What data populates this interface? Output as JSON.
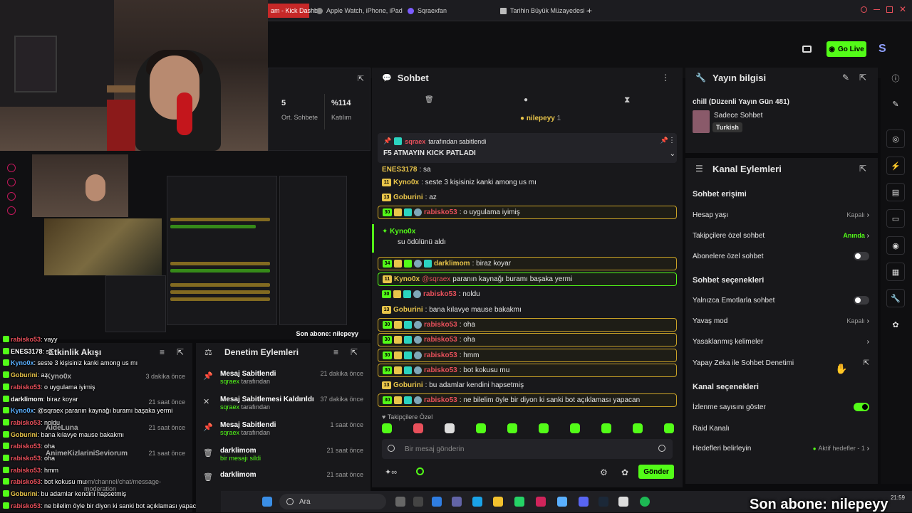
{
  "browser": {
    "tabs": [
      {
        "label": "am - Kick Dashb",
        "active": true
      },
      {
        "label": "Apple Watch, iPhone, iPad"
      },
      {
        "label": "Sqraexfan"
      },
      {
        "label": "Tarihin Büyük Müzayedesi –"
      }
    ]
  },
  "topbar": {
    "go_live": "Go Live",
    "brand": "S"
  },
  "stats": {
    "count": "5",
    "count_label": "Ort. Sohbete",
    "pct": "%114",
    "pct_label": "Katılım"
  },
  "preview": {
    "overlay_text": "Son abone: nilepeyy"
  },
  "left_chat": [
    {
      "user": "rabisko53",
      "text": ": vayy"
    },
    {
      "user": "ENES3178",
      "text": ": sa"
    },
    {
      "user": "Kyno0x",
      "text": ": seste 3 kişisiniz kanki among us mı"
    },
    {
      "user": "Goburini",
      "text": ": az"
    },
    {
      "user": "rabisko53",
      "text": ": o uygulama iyimiş"
    },
    {
      "user": "darklimom",
      "text": ": biraz koyar"
    },
    {
      "user": "Kyno0x",
      "text": ": @sqraex paranın kaynağı buramı başaka yermi"
    },
    {
      "user": "rabisko53",
      "text": ": noldu"
    },
    {
      "user": "Goburini",
      "text": ": bana kılavye mause bakakmı"
    },
    {
      "user": "rabisko53",
      "text": ": oha"
    },
    {
      "user": "rabisko53",
      "text": ": oha"
    },
    {
      "user": "rabisko53",
      "text": ": hmm"
    },
    {
      "user": "rabisko53",
      "text": ": bot kokusu mu"
    },
    {
      "user": "Goburini",
      "text": ": bu adamlar kendini hapsetmiş"
    },
    {
      "user": "rabisko53",
      "text": ": ne bilelim öyle bir diyon ki sanki bot açıklaması yapacan"
    }
  ],
  "etkinlik": {
    "title": "Etkinlik Akışı",
    "items": [
      {
        "name": "Kyno0x",
        "time": "3 dakika önce"
      },
      {
        "name": "",
        "time": "21 saat önce"
      },
      {
        "name": "AldeLuna",
        "time": "21 saat önce"
      },
      {
        "name": "AnimeKizlariniSeviorum",
        "time": "21 saat önce"
      }
    ],
    "url_fragment": "om/channel/chat/message-moderation"
  },
  "denetim": {
    "title": "Denetim Eylemleri",
    "items": [
      {
        "title": "Mesaj Sabitlendi",
        "sub": "sqraex",
        "sub2": " tarafından",
        "time": "21 dakika önce"
      },
      {
        "title": "Mesaj Sabitlemesi Kaldırıldı",
        "sub": "sqraex",
        "sub2": " tarafından",
        "time": "37 dakika önce"
      },
      {
        "title": "Mesaj Sabitlendi",
        "sub": "sqraex",
        "sub2": " tarafından",
        "time": "1 saat önce"
      },
      {
        "title": "darklimom",
        "sub": "bir mesajı sildi",
        "sub2": "",
        "time": "21 saat önce"
      },
      {
        "title": "darklimom",
        "sub": "",
        "sub2": "",
        "time": "21 saat önce"
      }
    ]
  },
  "sohbet": {
    "title": "Sohbet",
    "top_user": "nilepeyy",
    "top_count": "1",
    "pinned_by": "sqraex",
    "pinned_by_suffix": " tarafından sabitlendi",
    "pinned_text": "F5 ATMAYIN KICK PATLADI",
    "reward_user": "Kyno0x",
    "reward_text": "su ödülünü aldı",
    "follower_label": "Takipçilere Özel",
    "input_placeholder": "Bir mesaj gönderin",
    "send": "Gönder",
    "messages": [
      {
        "user": "ENES3178",
        "text": ": sa"
      },
      {
        "user": "Kyno0x",
        "text": ": seste 3 kişisiniz kanki among us mı"
      },
      {
        "user": "Goburini",
        "text": ": az"
      },
      {
        "user": "rabisko53",
        "text": ": o uygulama iyimiş"
      },
      {
        "user": "darklimom",
        "text": ": biraz koyar"
      },
      {
        "user": "Kyno0x",
        "mention": "@sqraex",
        "text": " paranın kaynağı buramı başaka yermi"
      },
      {
        "user": "rabisko53",
        "text": ": noldu"
      },
      {
        "user": "Goburini",
        "text": ": bana kılavye mause bakakmı"
      },
      {
        "user": "rabisko53",
        "text": ": oha"
      },
      {
        "user": "rabisko53",
        "text": ": oha"
      },
      {
        "user": "rabisko53",
        "text": ": hmm"
      },
      {
        "user": "rabisko53",
        "text": ": bot kokusu mu"
      },
      {
        "user": "Goburini",
        "text": ": bu adamlar kendini hapsetmiş"
      },
      {
        "user": "rabisko53",
        "text": ": ne bilelim öyle bir diyon ki sanki bot açıklaması yapacan"
      }
    ],
    "badge_30": "30",
    "badge_11": "11",
    "badge_13": "13",
    "badge_34": "34"
  },
  "yayin": {
    "title": "Yayın bilgisi",
    "stream_title": "chill (Düzenli Yayın Gün 481)",
    "category": "Sadece Sohbet",
    "language": "Turkish"
  },
  "kanal": {
    "title": "Kanal Eylemleri",
    "sec1": "Sohbet erişimi",
    "hesap": "Hesap yaşı",
    "hesap_val": "Kapalı",
    "takipci": "Takipçilere özel sohbet",
    "takipci_val": "Anında",
    "abone": "Abonelere özel sohbet",
    "sec2": "Sohbet seçenekleri",
    "emote": "Yalnızca Emotlarla sohbet",
    "yavas": "Yavaş mod",
    "yavas_val": "Kapalı",
    "yasak": "Yasaklanmış kelimeler",
    "ai": "Yapay Zeka ile Sohbet Denetimi",
    "sec3": "Kanal seçenekleri",
    "izlenme": "İzlenme sayısını göster",
    "raid": "Raid Kanalı",
    "hedef": "Hedefleri belirleyin",
    "hedef_val": "Aktif hedefler - 1"
  },
  "taskbar": {
    "search": "Ara",
    "time": "21:59",
    "date": ""
  },
  "alert": {
    "text": "Son abone: nilepeyy"
  },
  "colors": {
    "accent": "#53fc18",
    "panel": "#18181b",
    "gold": "#e9c54a",
    "red": "#e8505b"
  }
}
